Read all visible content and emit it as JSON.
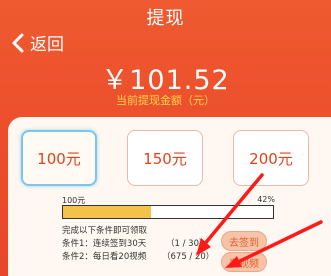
{
  "header": {
    "title": "提现",
    "back_label": "返回"
  },
  "balance": {
    "amount": "￥101.52",
    "label": "当前提现金额（元）"
  },
  "amount_options": [
    {
      "label": "100元",
      "selected": true
    },
    {
      "label": "150元",
      "selected": false
    },
    {
      "label": "200元",
      "selected": false
    }
  ],
  "progress": {
    "left_label": "100元",
    "right_label": "42%",
    "percent": 42
  },
  "conditions": {
    "heading": "完成以下条件即可领取",
    "items": [
      {
        "text": "条件1：连续签到30天",
        "progress": "（1 / 30）",
        "button": "去签到"
      },
      {
        "text": "条件2：每日看20视频",
        "progress": "（675 / 20）",
        "button": "看视频"
      }
    ]
  },
  "colors": {
    "background": "#ec4f2c",
    "accent_yellow": "#ffd54a",
    "panel": "#fff8f2",
    "annotation_arrow": "#ff1a1a"
  }
}
